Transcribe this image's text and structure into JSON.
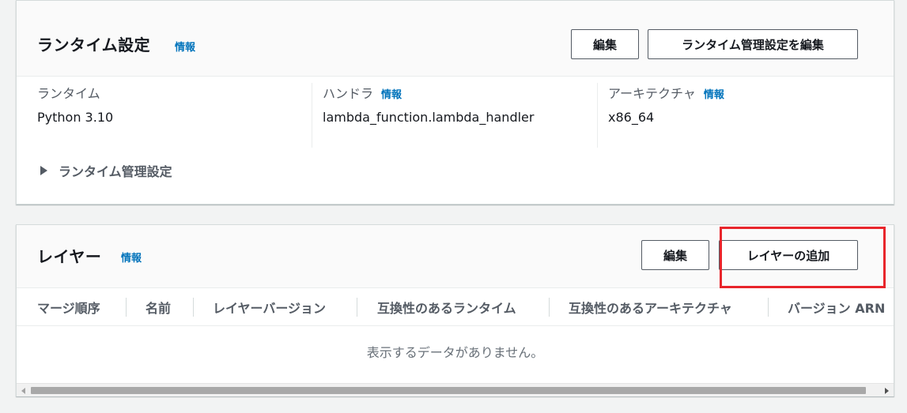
{
  "runtime_settings": {
    "title": "ランタイム設定",
    "info_label": "情報",
    "edit_button": "編集",
    "edit_management_button": "ランタイム管理設定を編集",
    "columns": [
      {
        "label": "ランタイム",
        "value": "Python 3.10",
        "info": ""
      },
      {
        "label": "ハンドラ",
        "value": "lambda_function.lambda_handler",
        "info": "情報"
      },
      {
        "label": "アーキテクチャ",
        "value": "x86_64",
        "info": "情報"
      }
    ],
    "expander_label": "ランタイム管理設定"
  },
  "layers": {
    "title": "レイヤー",
    "info_label": "情報",
    "edit_button": "編集",
    "add_button": "レイヤーの追加",
    "table_headers": [
      "マージ順序",
      "名前",
      "レイヤーバージョン",
      "互換性のあるランタイム",
      "互換性のあるアーキテクチャ",
      "バージョン ARN"
    ],
    "empty_message": "表示するデータがありません。"
  },
  "colors": {
    "link": "#0073bb",
    "highlight": "#e8252b",
    "button_border": "#545b64"
  }
}
